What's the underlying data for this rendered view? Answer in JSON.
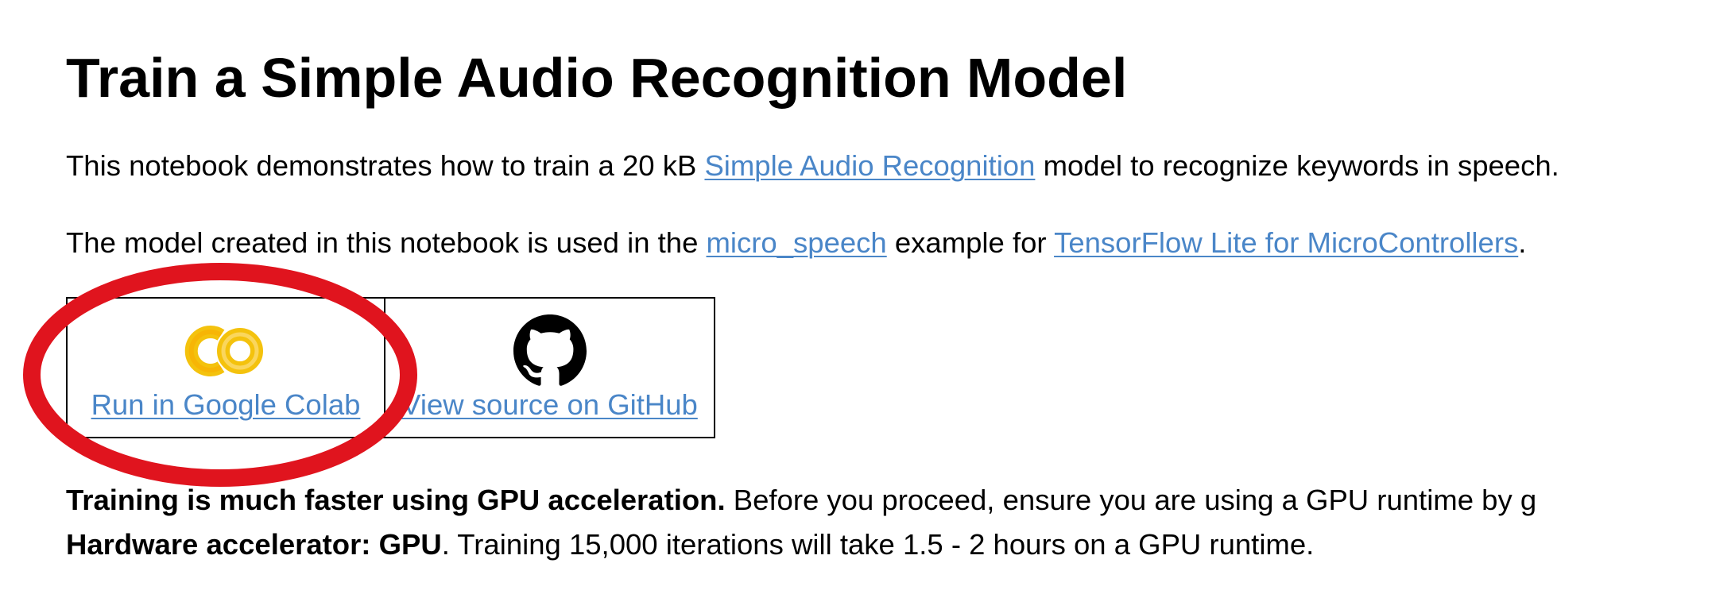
{
  "title": "Train a Simple Audio Recognition Model",
  "intro": {
    "text_before": "This notebook demonstrates how to train a 20 kB ",
    "link": "Simple Audio Recognition",
    "text_after": " model to recognize keywords in speech."
  },
  "usage": {
    "text_before": "The model created in this notebook is used in the ",
    "link1": "micro_speech",
    "text_middle": " example for ",
    "link2": "TensorFlow Lite for MicroControllers",
    "text_after": "."
  },
  "badges": {
    "colab_label": "Run in Google Colab",
    "github_label": "View source on GitHub"
  },
  "gpu_note": {
    "bold_lead": "Training is much faster using GPU acceleration.",
    "text": " Before you proceed, ensure you are using a GPU runtime by g",
    "bold_setting": "Hardware accelerator: GPU",
    "text2": ". Training 15,000 iterations will take 1.5 - 2 hours on a GPU runtime."
  },
  "colors": {
    "link": "#4a86c8",
    "annotation_circle": "#e0141e",
    "colab_logo": "#f4c20d"
  }
}
